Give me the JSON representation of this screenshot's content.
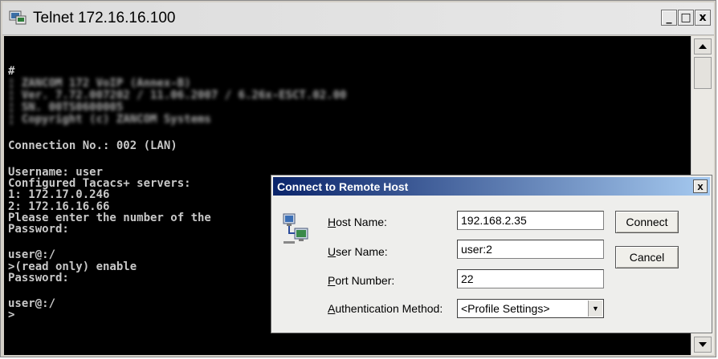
{
  "window": {
    "title": "Telnet 172.16.16.100",
    "buttons": {
      "minimize": "_",
      "maximize": "□",
      "close": "x"
    }
  },
  "console": {
    "lines": [
      "#",
      "¦ ZANCOM 172 VoIP (Annex-B)",
      "¦ Ver. 7.72.007202 / 11.06.2007 / 6.26x-ESCT.02.00",
      "¦ SN. 00TS0600005",
      "¦ Copyright (c) ZANCOM Systems",
      "Connection No.: 002 (LAN)",
      "Username: user",
      "Configured Tacacs+ servers:",
      "1: 172.17.0.246",
      "2: 172.16.16.66",
      "Please enter the number of the",
      "Password:",
      "user@:/",
      ">(read only) enable",
      "Password:",
      "user@:/",
      ">"
    ]
  },
  "dialog": {
    "title": "Connect to Remote Host",
    "close_label": "x",
    "labels": {
      "host_first": "H",
      "host_rest": "ost Name:",
      "user_first": "U",
      "user_rest": "ser Name:",
      "port_first": "P",
      "port_rest": "ort Number:",
      "auth_first": "A",
      "auth_rest": "uthentication Method:"
    },
    "values": {
      "host_name": "192.168.2.35",
      "user_name": "user:2",
      "port_number": "22",
      "auth_method": "<Profile Settings>"
    },
    "buttons": {
      "connect": "Connect",
      "cancel": "Cancel"
    },
    "icons": {
      "dialog_icon": "network-computers-icon"
    }
  }
}
